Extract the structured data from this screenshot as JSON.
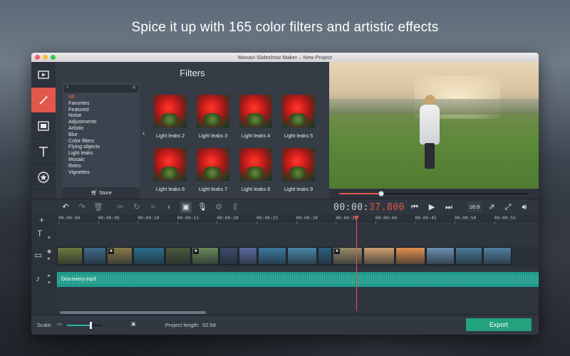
{
  "headline": "Spice it up with 165 color filters and artistic effects",
  "window": {
    "title": "Movavi Slideshow Maker – New Project"
  },
  "rail": {
    "items": [
      "video-icon",
      "magic-wand-icon",
      "transition-icon",
      "text-icon",
      "stickers-icon",
      "menu-icon"
    ]
  },
  "filters": {
    "title": "Filters",
    "categories": [
      "All",
      "Favorites",
      "Featured",
      "Noise",
      "Adjustments",
      "Artistic",
      "Blur",
      "Color filters",
      "Flying objects",
      "Light leaks",
      "Mosaic",
      "Retro",
      "Vignettes"
    ],
    "active_category": "All",
    "store_label": "Store",
    "thumbnails": [
      "Light leaks 2",
      "Light leaks 3",
      "Light leaks 4",
      "Light leaks 5",
      "Light leaks 6",
      "Light leaks 7",
      "Light leaks 8",
      "Light leaks 9"
    ]
  },
  "player": {
    "seek_progress": 0.22,
    "timecode_main": "00:00:",
    "timecode_ms": "37.800",
    "aspect_ratio": "16:9"
  },
  "timeline": {
    "ruler_ticks": [
      "00:00:00",
      "00:00:05",
      "00:00:10",
      "00:00:15",
      "00:00:20",
      "00:00:25",
      "00:00:30",
      "00:00:35",
      "00:00:40",
      "00:00:45",
      "00:00:50",
      "00:00:55"
    ],
    "audio_clip": "Discovery.mp3",
    "clip_colors": [
      "#6b7a3c",
      "#3f6a8a",
      "#8a7a4a",
      "#2b6e8e",
      "#4a5a3a",
      "#6a8a5a",
      "#3c4c6a",
      "#5a6aa0",
      "#3a7aa0",
      "#4a86a6",
      "#2a6080",
      "#9a8a6a",
      "#d0a070",
      "#e09050",
      "#6a90b0",
      "#4a7a9a",
      "#5080a0",
      "#c08050"
    ]
  },
  "bottombar": {
    "scale_label": "Scale:",
    "scale_value": 0.65,
    "project_length_label": "Project length:",
    "project_length": "02:58",
    "export_label": "Export"
  },
  "colors": {
    "accent": "#e2574c",
    "export": "#23a37d",
    "audio": "#1f9b8b"
  }
}
